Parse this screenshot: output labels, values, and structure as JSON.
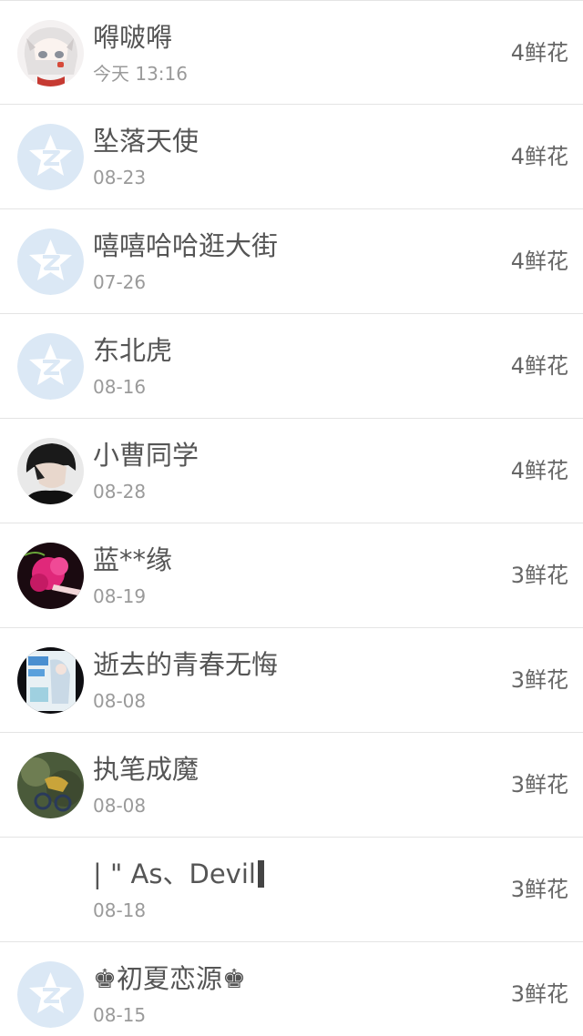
{
  "records": [
    {
      "name": "嘚啵嘚",
      "date": "今天 13:16",
      "flowers": "4鲜花",
      "avatar": "anime-white-hair"
    },
    {
      "name": "坠落天使",
      "date": "08-23",
      "flowers": "4鲜花",
      "avatar": "qzone-default"
    },
    {
      "name": "嘻嘻哈哈逛大街",
      "date": "07-26",
      "flowers": "4鲜花",
      "avatar": "qzone-default"
    },
    {
      "name": "东北虎",
      "date": "08-16",
      "flowers": "4鲜花",
      "avatar": "qzone-default"
    },
    {
      "name": "小曹同学",
      "date": "08-28",
      "flowers": "4鲜花",
      "avatar": "dark-hair-boy"
    },
    {
      "name": "蓝**缘",
      "date": "08-19",
      "flowers": "3鲜花",
      "avatar": "pink-flower"
    },
    {
      "name": "逝去的青春无悔",
      "date": "08-08",
      "flowers": "3鲜花",
      "avatar": "anime-poster"
    },
    {
      "name": "执笔成魔",
      "date": "08-08",
      "flowers": "3鲜花",
      "avatar": "green-scene"
    },
    {
      "name": "| \" As、Devil",
      "date": "08-18",
      "flowers": "3鲜花",
      "avatar": "none"
    },
    {
      "name": "♚初夏恋源♚",
      "date": "08-15",
      "flowers": "3鲜花",
      "avatar": "qzone-default"
    }
  ],
  "colors": {
    "text_primary": "#555555",
    "text_secondary": "#9a9a9a",
    "divider": "#e4e4e4",
    "qzone_avatar": "#dbe8f5"
  }
}
